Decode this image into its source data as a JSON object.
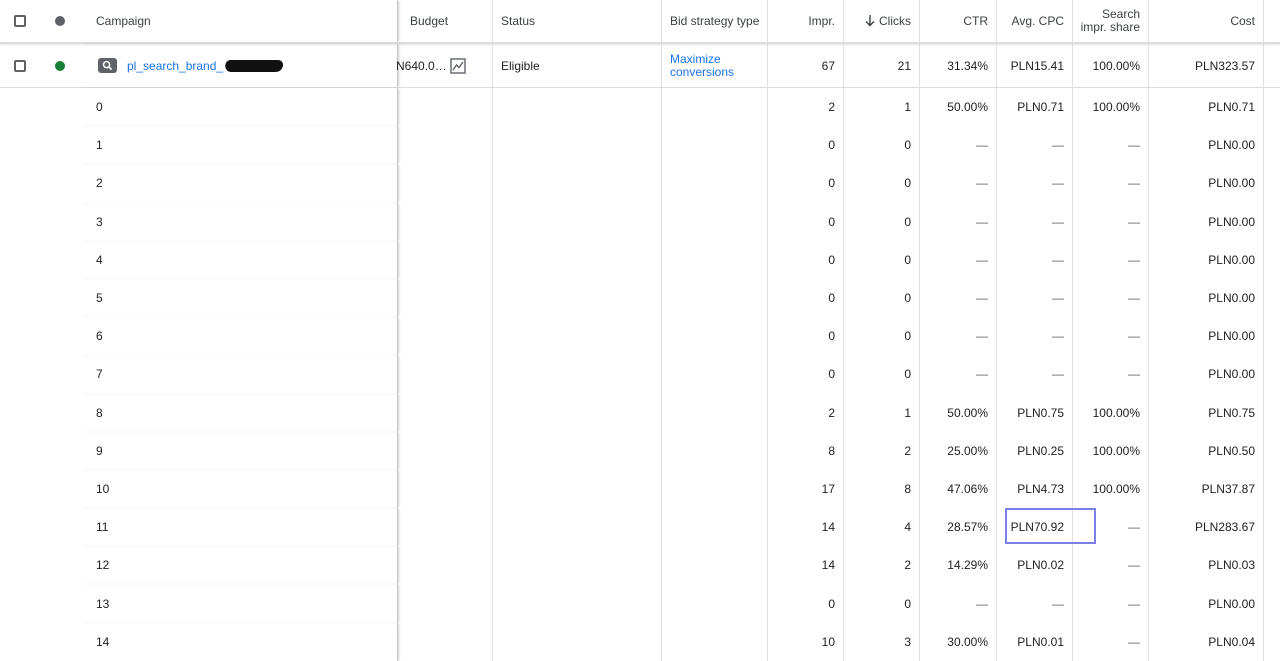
{
  "colors": {
    "link": "#1a73e8",
    "status_eligible_dot": "#188038",
    "highlight_border": "#7b7fe8"
  },
  "header": {
    "campaign": "Campaign",
    "budget": "Budget",
    "status": "Status",
    "bid_strategy_type": "Bid strategy type",
    "impr": "Impr.",
    "clicks": "Clicks",
    "ctr": "CTR",
    "avg_cpc": "Avg. CPC",
    "search_impr_share_line1": "Search",
    "search_impr_share_line2": "impr. share",
    "cost": "Cost"
  },
  "campaign_row": {
    "name": "pl_search_brand_",
    "budget": "N640.0…",
    "status": "Eligible",
    "bid_strategy_line1": "Maximize",
    "bid_strategy_line2": "conversions",
    "impr": "67",
    "clicks": "21",
    "ctr": "31.34%",
    "avg_cpc": "PLN15.41",
    "search_impr_share": "100.00%",
    "cost": "PLN323.57"
  },
  "segments": [
    {
      "label": "0",
      "impr": "2",
      "clicks": "1",
      "ctr": "50.00%",
      "avg_cpc": "PLN0.71",
      "share": "100.00%",
      "cost": "PLN0.71"
    },
    {
      "label": "1",
      "impr": "0",
      "clicks": "0",
      "ctr": "—",
      "avg_cpc": "—",
      "share": "—",
      "cost": "PLN0.00"
    },
    {
      "label": "2",
      "impr": "0",
      "clicks": "0",
      "ctr": "—",
      "avg_cpc": "—",
      "share": "—",
      "cost": "PLN0.00"
    },
    {
      "label": "3",
      "impr": "0",
      "clicks": "0",
      "ctr": "—",
      "avg_cpc": "—",
      "share": "—",
      "cost": "PLN0.00"
    },
    {
      "label": "4",
      "impr": "0",
      "clicks": "0",
      "ctr": "—",
      "avg_cpc": "—",
      "share": "—",
      "cost": "PLN0.00"
    },
    {
      "label": "5",
      "impr": "0",
      "clicks": "0",
      "ctr": "—",
      "avg_cpc": "—",
      "share": "—",
      "cost": "PLN0.00"
    },
    {
      "label": "6",
      "impr": "0",
      "clicks": "0",
      "ctr": "—",
      "avg_cpc": "—",
      "share": "—",
      "cost": "PLN0.00"
    },
    {
      "label": "7",
      "impr": "0",
      "clicks": "0",
      "ctr": "—",
      "avg_cpc": "—",
      "share": "—",
      "cost": "PLN0.00"
    },
    {
      "label": "8",
      "impr": "2",
      "clicks": "1",
      "ctr": "50.00%",
      "avg_cpc": "PLN0.75",
      "share": "100.00%",
      "cost": "PLN0.75"
    },
    {
      "label": "9",
      "impr": "8",
      "clicks": "2",
      "ctr": "25.00%",
      "avg_cpc": "PLN0.25",
      "share": "100.00%",
      "cost": "PLN0.50"
    },
    {
      "label": "10",
      "impr": "17",
      "clicks": "8",
      "ctr": "47.06%",
      "avg_cpc": "PLN4.73",
      "share": "100.00%",
      "cost": "PLN37.87"
    },
    {
      "label": "11",
      "impr": "14",
      "clicks": "4",
      "ctr": "28.57%",
      "avg_cpc": "PLN70.92",
      "share": "—",
      "cost": "PLN283.67"
    },
    {
      "label": "12",
      "impr": "14",
      "clicks": "2",
      "ctr": "14.29%",
      "avg_cpc": "PLN0.02",
      "share": "—",
      "cost": "PLN0.03"
    },
    {
      "label": "13",
      "impr": "0",
      "clicks": "0",
      "ctr": "—",
      "avg_cpc": "—",
      "share": "—",
      "cost": "PLN0.00"
    },
    {
      "label": "14",
      "impr": "10",
      "clicks": "3",
      "ctr": "30.00%",
      "avg_cpc": "PLN0.01",
      "share": "—",
      "cost": "PLN0.04"
    }
  ]
}
